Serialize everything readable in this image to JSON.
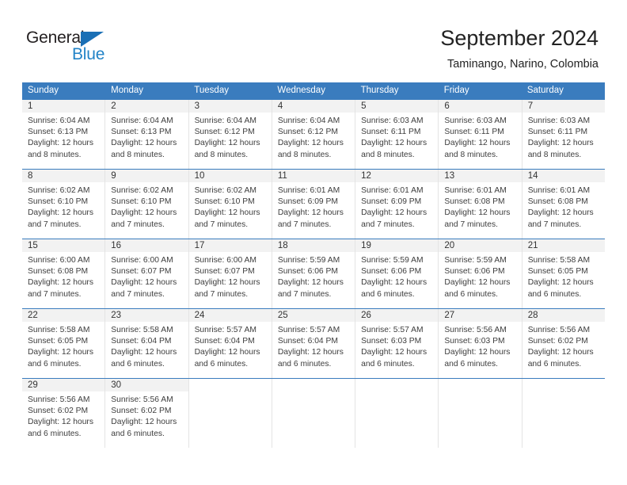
{
  "logo": {
    "word_one": "General",
    "word_two": "Blue",
    "triangle_color": "#1a6fb5",
    "word_two_color": "#2283c7"
  },
  "header": {
    "title": "September 2024",
    "subtitle": "Taminango, Narino, Colombia"
  },
  "theme": {
    "header_blue": "#3a7cbe",
    "daynum_band": "#f2f2f2",
    "cell_border": "#e4e4e4"
  },
  "weekdays": [
    "Sunday",
    "Monday",
    "Tuesday",
    "Wednesday",
    "Thursday",
    "Friday",
    "Saturday"
  ],
  "weeks": [
    [
      {
        "day": "1",
        "sunrise": "Sunrise: 6:04 AM",
        "sunset": "Sunset: 6:13 PM",
        "daylight": "Daylight: 12 hours and 8 minutes."
      },
      {
        "day": "2",
        "sunrise": "Sunrise: 6:04 AM",
        "sunset": "Sunset: 6:13 PM",
        "daylight": "Daylight: 12 hours and 8 minutes."
      },
      {
        "day": "3",
        "sunrise": "Sunrise: 6:04 AM",
        "sunset": "Sunset: 6:12 PM",
        "daylight": "Daylight: 12 hours and 8 minutes."
      },
      {
        "day": "4",
        "sunrise": "Sunrise: 6:04 AM",
        "sunset": "Sunset: 6:12 PM",
        "daylight": "Daylight: 12 hours and 8 minutes."
      },
      {
        "day": "5",
        "sunrise": "Sunrise: 6:03 AM",
        "sunset": "Sunset: 6:11 PM",
        "daylight": "Daylight: 12 hours and 8 minutes."
      },
      {
        "day": "6",
        "sunrise": "Sunrise: 6:03 AM",
        "sunset": "Sunset: 6:11 PM",
        "daylight": "Daylight: 12 hours and 8 minutes."
      },
      {
        "day": "7",
        "sunrise": "Sunrise: 6:03 AM",
        "sunset": "Sunset: 6:11 PM",
        "daylight": "Daylight: 12 hours and 8 minutes."
      }
    ],
    [
      {
        "day": "8",
        "sunrise": "Sunrise: 6:02 AM",
        "sunset": "Sunset: 6:10 PM",
        "daylight": "Daylight: 12 hours and 7 minutes."
      },
      {
        "day": "9",
        "sunrise": "Sunrise: 6:02 AM",
        "sunset": "Sunset: 6:10 PM",
        "daylight": "Daylight: 12 hours and 7 minutes."
      },
      {
        "day": "10",
        "sunrise": "Sunrise: 6:02 AM",
        "sunset": "Sunset: 6:10 PM",
        "daylight": "Daylight: 12 hours and 7 minutes."
      },
      {
        "day": "11",
        "sunrise": "Sunrise: 6:01 AM",
        "sunset": "Sunset: 6:09 PM",
        "daylight": "Daylight: 12 hours and 7 minutes."
      },
      {
        "day": "12",
        "sunrise": "Sunrise: 6:01 AM",
        "sunset": "Sunset: 6:09 PM",
        "daylight": "Daylight: 12 hours and 7 minutes."
      },
      {
        "day": "13",
        "sunrise": "Sunrise: 6:01 AM",
        "sunset": "Sunset: 6:08 PM",
        "daylight": "Daylight: 12 hours and 7 minutes."
      },
      {
        "day": "14",
        "sunrise": "Sunrise: 6:01 AM",
        "sunset": "Sunset: 6:08 PM",
        "daylight": "Daylight: 12 hours and 7 minutes."
      }
    ],
    [
      {
        "day": "15",
        "sunrise": "Sunrise: 6:00 AM",
        "sunset": "Sunset: 6:08 PM",
        "daylight": "Daylight: 12 hours and 7 minutes."
      },
      {
        "day": "16",
        "sunrise": "Sunrise: 6:00 AM",
        "sunset": "Sunset: 6:07 PM",
        "daylight": "Daylight: 12 hours and 7 minutes."
      },
      {
        "day": "17",
        "sunrise": "Sunrise: 6:00 AM",
        "sunset": "Sunset: 6:07 PM",
        "daylight": "Daylight: 12 hours and 7 minutes."
      },
      {
        "day": "18",
        "sunrise": "Sunrise: 5:59 AM",
        "sunset": "Sunset: 6:06 PM",
        "daylight": "Daylight: 12 hours and 7 minutes."
      },
      {
        "day": "19",
        "sunrise": "Sunrise: 5:59 AM",
        "sunset": "Sunset: 6:06 PM",
        "daylight": "Daylight: 12 hours and 6 minutes."
      },
      {
        "day": "20",
        "sunrise": "Sunrise: 5:59 AM",
        "sunset": "Sunset: 6:06 PM",
        "daylight": "Daylight: 12 hours and 6 minutes."
      },
      {
        "day": "21",
        "sunrise": "Sunrise: 5:58 AM",
        "sunset": "Sunset: 6:05 PM",
        "daylight": "Daylight: 12 hours and 6 minutes."
      }
    ],
    [
      {
        "day": "22",
        "sunrise": "Sunrise: 5:58 AM",
        "sunset": "Sunset: 6:05 PM",
        "daylight": "Daylight: 12 hours and 6 minutes."
      },
      {
        "day": "23",
        "sunrise": "Sunrise: 5:58 AM",
        "sunset": "Sunset: 6:04 PM",
        "daylight": "Daylight: 12 hours and 6 minutes."
      },
      {
        "day": "24",
        "sunrise": "Sunrise: 5:57 AM",
        "sunset": "Sunset: 6:04 PM",
        "daylight": "Daylight: 12 hours and 6 minutes."
      },
      {
        "day": "25",
        "sunrise": "Sunrise: 5:57 AM",
        "sunset": "Sunset: 6:04 PM",
        "daylight": "Daylight: 12 hours and 6 minutes."
      },
      {
        "day": "26",
        "sunrise": "Sunrise: 5:57 AM",
        "sunset": "Sunset: 6:03 PM",
        "daylight": "Daylight: 12 hours and 6 minutes."
      },
      {
        "day": "27",
        "sunrise": "Sunrise: 5:56 AM",
        "sunset": "Sunset: 6:03 PM",
        "daylight": "Daylight: 12 hours and 6 minutes."
      },
      {
        "day": "28",
        "sunrise": "Sunrise: 5:56 AM",
        "sunset": "Sunset: 6:02 PM",
        "daylight": "Daylight: 12 hours and 6 minutes."
      }
    ],
    [
      {
        "day": "29",
        "sunrise": "Sunrise: 5:56 AM",
        "sunset": "Sunset: 6:02 PM",
        "daylight": "Daylight: 12 hours and 6 minutes."
      },
      {
        "day": "30",
        "sunrise": "Sunrise: 5:56 AM",
        "sunset": "Sunset: 6:02 PM",
        "daylight": "Daylight: 12 hours and 6 minutes."
      },
      {
        "day": "",
        "sunrise": "",
        "sunset": "",
        "daylight": ""
      },
      {
        "day": "",
        "sunrise": "",
        "sunset": "",
        "daylight": ""
      },
      {
        "day": "",
        "sunrise": "",
        "sunset": "",
        "daylight": ""
      },
      {
        "day": "",
        "sunrise": "",
        "sunset": "",
        "daylight": ""
      },
      {
        "day": "",
        "sunrise": "",
        "sunset": "",
        "daylight": ""
      }
    ]
  ]
}
